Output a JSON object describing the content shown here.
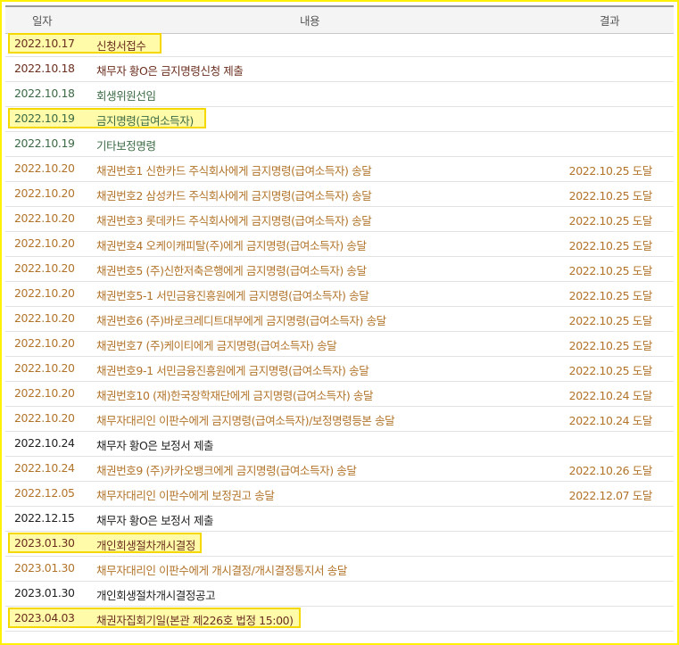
{
  "header": {
    "date_label": "일자",
    "content_label": "내용",
    "result_label": "결과"
  },
  "rows": [
    {
      "date": "2022.10.17",
      "content": "신청서접수",
      "result": "",
      "color": "#6b2f1f",
      "tone": "brown",
      "highlighted": true
    },
    {
      "date": "2022.10.18",
      "content": "채무자 황O은 금지명령신청 제출",
      "result": "",
      "color": "#6b2f1f",
      "tone": "brown",
      "highlighted": false
    },
    {
      "date": "2022.10.18",
      "content": "회생위원선임",
      "result": "",
      "color": "#3c6a44",
      "tone": "green",
      "highlighted": false
    },
    {
      "date": "2022.10.19",
      "content": "금지명령(급여소득자)",
      "result": "",
      "color": "#3c6a44",
      "tone": "green",
      "highlighted": true
    },
    {
      "date": "2022.10.19",
      "content": "기타보정명령",
      "result": "",
      "color": "#3c6a44",
      "tone": "green",
      "highlighted": false
    },
    {
      "date": "2022.10.20",
      "content": "채권번호1 신한카드 주식회사에게 금지명령(급여소득자) 송달",
      "result": "2022.10.25 도달",
      "color": "#b2742a",
      "tone": "orange",
      "highlighted": false
    },
    {
      "date": "2022.10.20",
      "content": "채권번호2 삼성카드 주식회사에게 금지명령(급여소득자) 송달",
      "result": "2022.10.25 도달",
      "color": "#b2742a",
      "tone": "orange",
      "highlighted": false
    },
    {
      "date": "2022.10.20",
      "content": "채권번호3 롯데카드 주식회사에게 금지명령(급여소득자) 송달",
      "result": "2022.10.25 도달",
      "color": "#b2742a",
      "tone": "orange",
      "highlighted": false
    },
    {
      "date": "2022.10.20",
      "content": "채권번호4 오케이캐피탈(주)에게 금지명령(급여소득자) 송달",
      "result": "2022.10.25 도달",
      "color": "#b2742a",
      "tone": "orange",
      "highlighted": false
    },
    {
      "date": "2022.10.20",
      "content": "채권번호5 (주)신한저축은행에게 금지명령(급여소득자) 송달",
      "result": "2022.10.25 도달",
      "color": "#b2742a",
      "tone": "orange",
      "highlighted": false
    },
    {
      "date": "2022.10.20",
      "content": "채권번호5-1 서민금융진흥원에게 금지명령(급여소득자) 송달",
      "result": "2022.10.25 도달",
      "color": "#b2742a",
      "tone": "orange",
      "highlighted": false
    },
    {
      "date": "2022.10.20",
      "content": "채권번호6 (주)바로크레디트대부에게 금지명령(급여소득자) 송달",
      "result": "2022.10.25 도달",
      "color": "#b2742a",
      "tone": "orange",
      "highlighted": false
    },
    {
      "date": "2022.10.20",
      "content": "채권번호7 (주)케이티에게 금지명령(급여소득자) 송달",
      "result": "2022.10.25 도달",
      "color": "#b2742a",
      "tone": "orange",
      "highlighted": false
    },
    {
      "date": "2022.10.20",
      "content": "채권번호9-1 서민금융진흥원에게 금지명령(급여소득자) 송달",
      "result": "2022.10.25 도달",
      "color": "#b2742a",
      "tone": "orange",
      "highlighted": false
    },
    {
      "date": "2022.10.20",
      "content": "채권번호10 (재)한국장학재단에게 금지명령(급여소득자) 송달",
      "result": "2022.10.24 도달",
      "color": "#b2742a",
      "tone": "orange",
      "highlighted": false
    },
    {
      "date": "2022.10.20",
      "content": "채무자대리인 이판수에게 금지명령(급여소득자)/보정명령등본 송달",
      "result": "2022.10.24 도달",
      "color": "#b2742a",
      "tone": "orange",
      "highlighted": false
    },
    {
      "date": "2022.10.24",
      "content": "채무자 황O은 보정서 제출",
      "result": "",
      "color": "#222222",
      "tone": "black",
      "highlighted": false
    },
    {
      "date": "2022.10.24",
      "content": "채권번호9 (주)카카오뱅크에게 금지명령(급여소득자) 송달",
      "result": "2022.10.26 도달",
      "color": "#b2742a",
      "tone": "orange",
      "highlighted": false
    },
    {
      "date": "2022.12.05",
      "content": "채무자대리인 이판수에게 보정권고 송달",
      "result": "2022.12.07 도달",
      "color": "#b2742a",
      "tone": "orange",
      "highlighted": false
    },
    {
      "date": "2022.12.15",
      "content": "채무자 황O은 보정서 제출",
      "result": "",
      "color": "#222222",
      "tone": "black",
      "highlighted": false
    },
    {
      "date": "2023.01.30",
      "content": "개인회생절차개시결정",
      "result": "",
      "color": "#6b2f1f",
      "tone": "brown",
      "highlighted": true
    },
    {
      "date": "2023.01.30",
      "content": "채무자대리인 이판수에게 개시결정/개시결정통지서 송달",
      "result": "",
      "color": "#b2742a",
      "tone": "orange",
      "highlighted": false
    },
    {
      "date": "2023.01.30",
      "content": "개인회생절차개시결정공고",
      "result": "",
      "color": "#222222",
      "tone": "black",
      "highlighted": false
    },
    {
      "date": "2023.04.03",
      "content": "채권자집회기일(본관 제226호 법정 15:00)",
      "result": "",
      "color": "#6b2f1f",
      "tone": "brown",
      "highlighted": true
    }
  ]
}
